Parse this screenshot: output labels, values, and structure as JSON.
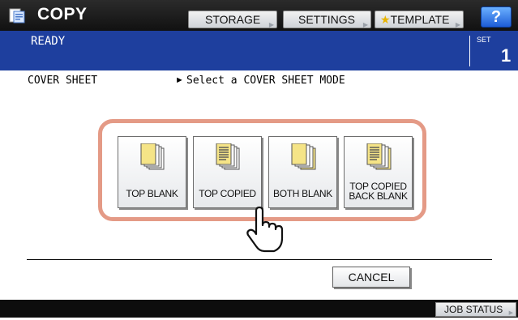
{
  "header": {
    "app_title": "COPY",
    "app_icon": "copy-icon",
    "storage_label": "STORAGE",
    "settings_label": "SETTINGS",
    "template_label": "TEMPLATE",
    "help_label": "?"
  },
  "status": {
    "state": "READY",
    "set_label": "SET",
    "set_value": "1"
  },
  "breadcrumb": {
    "section": "COVER SHEET",
    "arrow": "►",
    "message": "Select a COVER SHEET MODE"
  },
  "modes": [
    {
      "label": "TOP BLANK",
      "icon": "top-blank-icon"
    },
    {
      "label": "TOP COPIED",
      "icon": "top-copied-icon"
    },
    {
      "label": "BOTH BLANK",
      "icon": "both-blank-icon"
    },
    {
      "label_line1": "TOP COPIED",
      "label_line2": "BACK BLANK",
      "icon": "top-copied-back-blank-icon"
    }
  ],
  "footer": {
    "cancel_label": "CANCEL",
    "job_status_label": "JOB STATUS"
  },
  "colors": {
    "header_bg": "#111111",
    "status_bg": "#1e3f9e",
    "highlight": "#e49a86",
    "help_btn": "#1d5cd6"
  }
}
